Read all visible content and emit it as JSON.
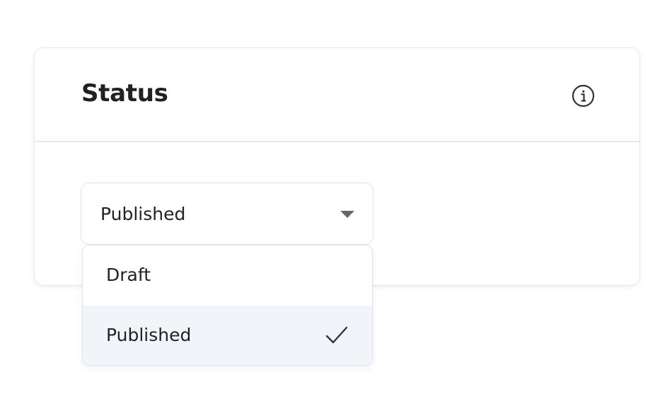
{
  "card": {
    "title": "Status",
    "info_icon": "info-circle-icon"
  },
  "status_select": {
    "value": "Published",
    "chevron_icon": "caret-down-icon",
    "options": [
      {
        "label": "Draft",
        "selected": false
      },
      {
        "label": "Published",
        "selected": true
      }
    ],
    "check_icon": "check-icon"
  },
  "colors": {
    "selected_option_bg": "#f1f5f9",
    "border": "#e1e3e6",
    "text": "#222222"
  }
}
